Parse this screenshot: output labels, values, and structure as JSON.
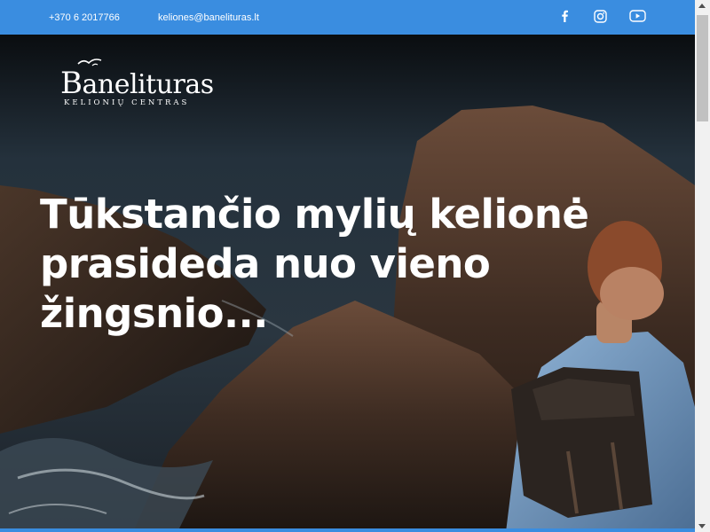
{
  "topbar": {
    "phone": "+370 6 2017766",
    "email": "keliones@banelituras.lt",
    "social": [
      "facebook-icon",
      "instagram-icon",
      "youtube-icon"
    ],
    "background": "#3a8de0"
  },
  "logo": {
    "brand_initial": "B",
    "brand_rest": "anelituras",
    "tagline": "KELIONIŲ CENTRAS"
  },
  "hero": {
    "headline_line1": "Tūkstančio mylių kelionė",
    "headline_line2": "prasideda nuo vieno",
    "headline_line3": "žingsnio..."
  }
}
